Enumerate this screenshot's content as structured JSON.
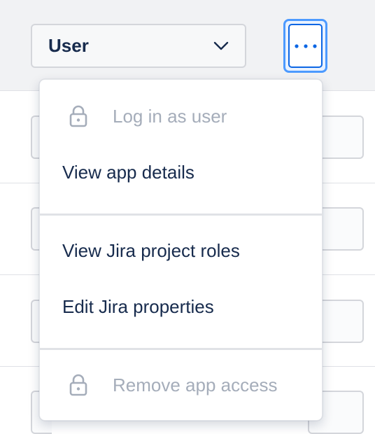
{
  "header": {
    "role_select": {
      "value": "User",
      "icon": "chevron-down-icon"
    },
    "more_button": {
      "icon": "more-horizontal-icon"
    }
  },
  "menu": {
    "items": [
      {
        "label": "Log in as user",
        "disabled": true,
        "icon": "lock-icon"
      },
      {
        "label": "View app details",
        "disabled": false
      },
      {
        "label": "View Jira project roles",
        "disabled": false
      },
      {
        "label": "Edit Jira properties",
        "disabled": false
      },
      {
        "label": "Remove app access",
        "disabled": true,
        "icon": "lock-icon"
      }
    ]
  },
  "colors": {
    "text": "#172b4d",
    "disabled_text": "#a5adba",
    "focus_ring": "#4c9aff",
    "header_bg": "#f1f2f4"
  }
}
